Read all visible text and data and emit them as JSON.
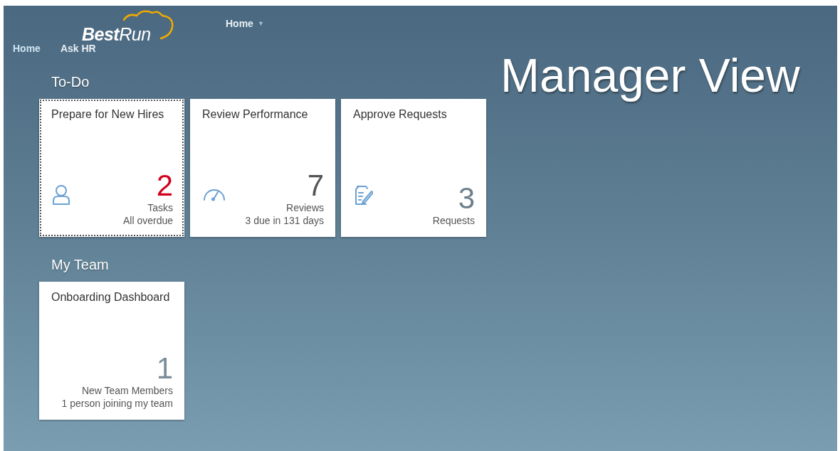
{
  "header": {
    "logo": "**Best**Run",
    "menu": {
      "label": "Home",
      "caret": "▼"
    }
  },
  "nav": [
    {
      "label": "Home",
      "selected": true
    },
    {
      "label": "Ask HR",
      "selected": false
    }
  ],
  "page_title": "Manager View",
  "groups": [
    {
      "title": "To-Do",
      "tiles": [
        {
          "title": "Prepare for New Hires",
          "kind": "person",
          "focused": true,
          "number": "2",
          "color": "#d0021b",
          "unit": "Tasks",
          "info": "All overdue"
        },
        {
          "title": "Review Performance",
          "kind": "gauge",
          "focused": false,
          "number": "7",
          "color": "#555555",
          "unit": "Reviews",
          "info": "3 due in 131 days"
        },
        {
          "title": "Approve Requests",
          "kind": "document",
          "focused": false,
          "number": "3",
          "color": "#6d7f8c",
          "unit": "Requests"
        }
      ]
    },
    {
      "title": "My Team",
      "tiles": [
        {
          "title": "Onboarding Dashboard",
          "kind": "plain",
          "focused": false,
          "number": "1",
          "color": "#7b8d99",
          "unit": "New Team Members",
          "info": "1 person joining my team"
        }
      ]
    }
  ]
}
